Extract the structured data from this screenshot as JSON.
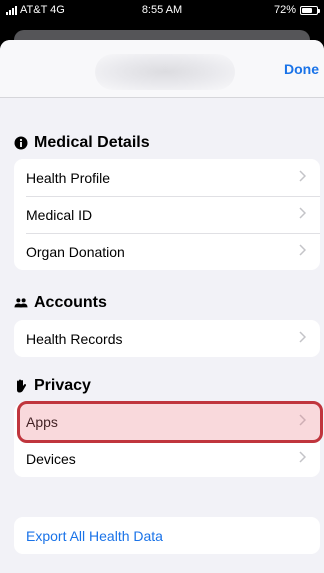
{
  "status_bar": {
    "carrier": "AT&T 4G",
    "time": "8:55 AM",
    "battery": "72%",
    "battery_level": 0.72
  },
  "nav": {
    "done_label": "Done"
  },
  "medical_details": {
    "title": "Medical Details",
    "icon": "info-circle-icon",
    "items": [
      {
        "label": "Health Profile"
      },
      {
        "label": "Medical ID"
      },
      {
        "label": "Organ Donation"
      }
    ]
  },
  "accounts": {
    "title": "Accounts",
    "icon": "people-icon",
    "items": [
      {
        "label": "Health Records"
      }
    ]
  },
  "privacy": {
    "title": "Privacy",
    "icon": "hand-icon",
    "items": [
      {
        "label": "Apps"
      },
      {
        "label": "Devices"
      }
    ]
  },
  "export": {
    "label": "Export All Health Data"
  },
  "colors": {
    "accent": "#1a73e8",
    "highlight_border": "#c0353d"
  }
}
